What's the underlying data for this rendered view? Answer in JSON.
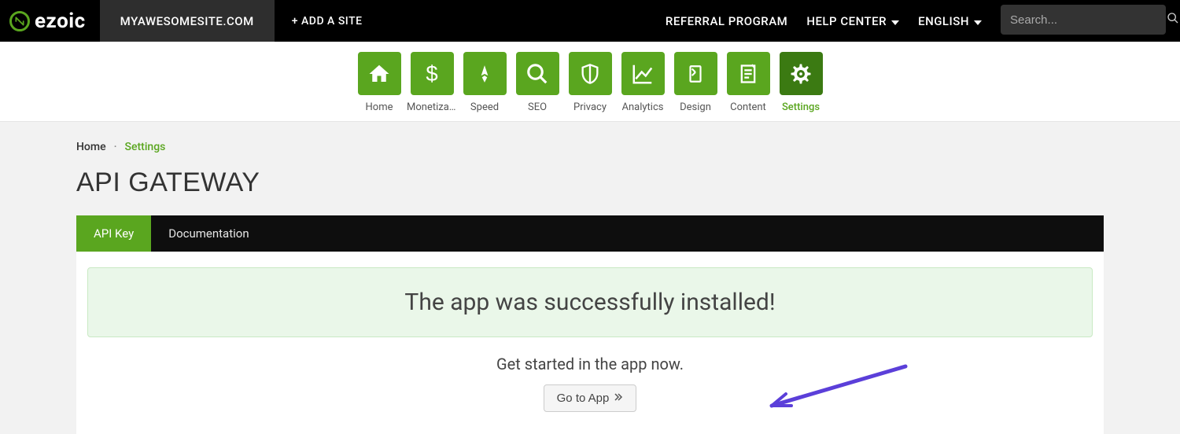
{
  "topbar": {
    "brand": "ezoic",
    "site": "MYAWESOMESITE.COM",
    "add_site": "+ ADD A SITE",
    "referral": "REFERRAL PROGRAM",
    "help_center": "HELP CENTER",
    "language": "ENGLISH",
    "search_placeholder": "Search..."
  },
  "nav": {
    "items": [
      {
        "label": "Home",
        "icon": "home-icon"
      },
      {
        "label": "Monetiza...",
        "icon": "dollar-icon"
      },
      {
        "label": "Speed",
        "icon": "rocket-icon"
      },
      {
        "label": "SEO",
        "icon": "magnify-icon"
      },
      {
        "label": "Privacy",
        "icon": "shield-icon"
      },
      {
        "label": "Analytics",
        "icon": "chart-icon"
      },
      {
        "label": "Design",
        "icon": "device-icon"
      },
      {
        "label": "Content",
        "icon": "document-icon"
      },
      {
        "label": "Settings",
        "icon": "gear-icon",
        "active": true
      }
    ]
  },
  "breadcrumb": {
    "home": "Home",
    "sep": "·",
    "current": "Settings"
  },
  "page": {
    "title": "API GATEWAY"
  },
  "tabs": {
    "api_key": "API Key",
    "documentation": "Documentation"
  },
  "alert": {
    "message": "The app was successfully installed!"
  },
  "cta": {
    "subtext": "Get started in the app now.",
    "button": "Go to App"
  }
}
